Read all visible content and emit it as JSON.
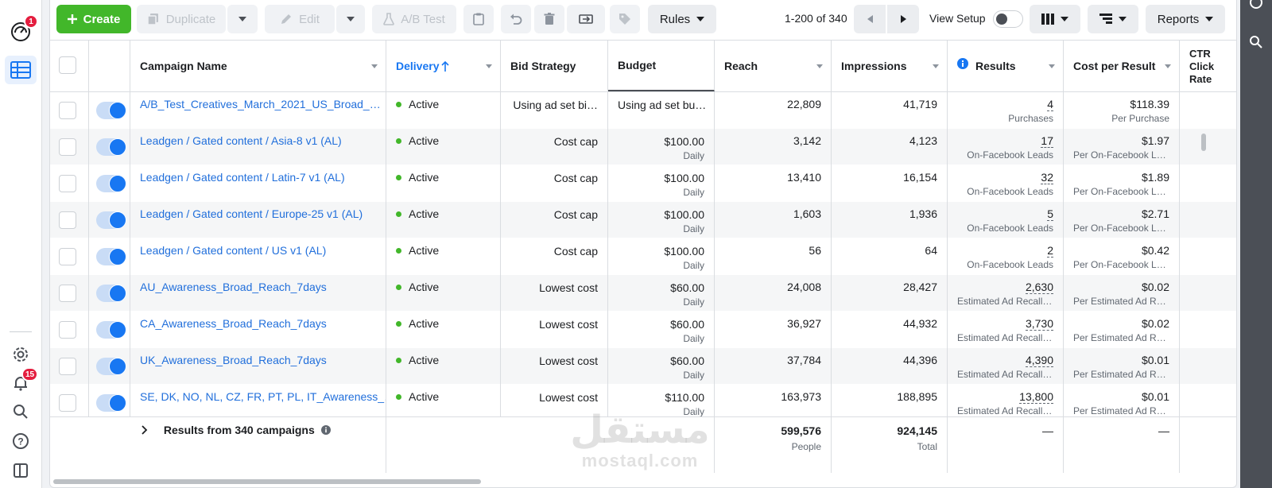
{
  "toolbar": {
    "create": "Create",
    "duplicate": "Duplicate",
    "edit": "Edit",
    "ab_test": "A/B Test",
    "rules": "Rules",
    "pager": "1-200 of 340",
    "view_setup": "View Setup",
    "reports": "Reports"
  },
  "rail": {
    "alerts_badge": "1",
    "notifications_badge": "15"
  },
  "columns": {
    "name": "Campaign Name",
    "delivery": "Delivery",
    "bid": "Bid Strategy",
    "budget": "Budget",
    "reach": "Reach",
    "impressions": "Impressions",
    "results": "Results",
    "cpr": "Cost per Result",
    "ctr": "CTR\nClick\nRate"
  },
  "rows": [
    {
      "name": "A/B_Test_Creatives_March_2021_US_Broad_…",
      "delivery": "Active",
      "bid": "Using ad set bi…",
      "budget": "Using ad set bu…",
      "budget_sub": "",
      "reach": "22,809",
      "impressions": "41,719",
      "results": "4",
      "results_sub": "Purchases",
      "cpr": "$118.39",
      "cpr_sub": "Per Purchase"
    },
    {
      "name": "Leadgen / Gated content / Asia-8 v1 (AL)",
      "delivery": "Active",
      "bid": "Cost cap",
      "budget": "$100.00",
      "budget_sub": "Daily",
      "reach": "3,142",
      "impressions": "4,123",
      "results": "17",
      "results_sub": "On-Facebook Leads",
      "cpr": "$1.97",
      "cpr_sub": "Per On-Facebook Le…"
    },
    {
      "name": "Leadgen / Gated content / Latin-7 v1 (AL)",
      "delivery": "Active",
      "bid": "Cost cap",
      "budget": "$100.00",
      "budget_sub": "Daily",
      "reach": "13,410",
      "impressions": "16,154",
      "results": "32",
      "results_sub": "On-Facebook Leads",
      "cpr": "$1.89",
      "cpr_sub": "Per On-Facebook Le…"
    },
    {
      "name": "Leadgen / Gated content / Europe-25 v1 (AL)",
      "delivery": "Active",
      "bid": "Cost cap",
      "budget": "$100.00",
      "budget_sub": "Daily",
      "reach": "1,603",
      "impressions": "1,936",
      "results": "5",
      "results_sub": "On-Facebook Leads",
      "cpr": "$2.71",
      "cpr_sub": "Per On-Facebook Le…"
    },
    {
      "name": "Leadgen / Gated content / US v1 (AL)",
      "delivery": "Active",
      "bid": "Cost cap",
      "budget": "$100.00",
      "budget_sub": "Daily",
      "reach": "56",
      "impressions": "64",
      "results": "2",
      "results_sub": "On-Facebook Leads",
      "cpr": "$0.42",
      "cpr_sub": "Per On-Facebook Le…"
    },
    {
      "name": "AU_Awareness_Broad_Reach_7days",
      "delivery": "Active",
      "bid": "Lowest cost",
      "budget": "$60.00",
      "budget_sub": "Daily",
      "reach": "24,008",
      "impressions": "28,427",
      "results": "2,630",
      "results_sub": "Estimated Ad Recall …",
      "cpr": "$0.02",
      "cpr_sub": "Per Estimated Ad Re…"
    },
    {
      "name": "CA_Awareness_Broad_Reach_7days",
      "delivery": "Active",
      "bid": "Lowest cost",
      "budget": "$60.00",
      "budget_sub": "Daily",
      "reach": "36,927",
      "impressions": "44,932",
      "results": "3,730",
      "results_sub": "Estimated Ad Recall …",
      "cpr": "$0.02",
      "cpr_sub": "Per Estimated Ad Re…"
    },
    {
      "name": "UK_Awareness_Broad_Reach_7days",
      "delivery": "Active",
      "bid": "Lowest cost",
      "budget": "$60.00",
      "budget_sub": "Daily",
      "reach": "37,784",
      "impressions": "44,396",
      "results": "4,390",
      "results_sub": "Estimated Ad Recall …",
      "cpr": "$0.01",
      "cpr_sub": "Per Estimated Ad Re…"
    },
    {
      "name": "SE, DK, NO, NL, CZ, FR, PT, PL, IT_Awareness_…",
      "delivery": "Active",
      "bid": "Lowest cost",
      "budget": "$110.00",
      "budget_sub": "Daily",
      "reach": "163,973",
      "impressions": "188,895",
      "results": "13,800",
      "results_sub": "Estimated Ad Recall …",
      "cpr": "$0.01",
      "cpr_sub": "Per Estimated Ad Re…"
    }
  ],
  "footer": {
    "label": "Results from 340 campaigns",
    "reach": "599,576",
    "reach_sub": "People",
    "impressions": "924,145",
    "impressions_sub": "Total",
    "results": "—",
    "cpr": "—"
  },
  "watermark": {
    "arabic": "مستقل",
    "latin": "mostaql.com"
  },
  "colors": {
    "create": "#42b72a",
    "link": "#216fdb",
    "active_dot": "#42b72a",
    "toggle": "#1877f2"
  }
}
